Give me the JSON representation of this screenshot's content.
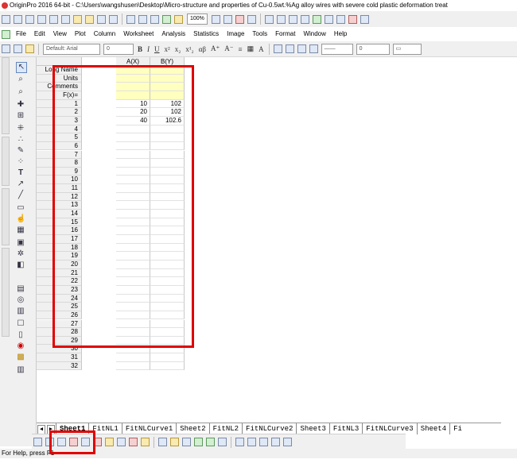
{
  "window": {
    "title": "OriginPro 2016 64-bit - C:\\Users\\wangshusen\\Desktop\\Micro-structure and properties of Cu-0.5wt.%Ag alloy wires with severe cold plastic deformation treat"
  },
  "toolbar": {
    "zoom": "100%"
  },
  "menu": [
    "File",
    "Edit",
    "View",
    "Plot",
    "Column",
    "Worksheet",
    "Analysis",
    "Statistics",
    "Image",
    "Tools",
    "Format",
    "Window",
    "Help"
  ],
  "format_bar": {
    "font": "Default: Arial",
    "size": "0",
    "line_width": "0"
  },
  "worksheet": {
    "columns": [
      "A(X)",
      "B(Y)"
    ],
    "meta_rows": [
      "Long Name",
      "Units",
      "Comments",
      "F(x)="
    ],
    "rows": [
      {
        "n": "1",
        "a": "10",
        "b": "102"
      },
      {
        "n": "2",
        "a": "20",
        "b": "102"
      },
      {
        "n": "3",
        "a": "40",
        "b": "102.6"
      },
      {
        "n": "4",
        "a": "",
        "b": ""
      },
      {
        "n": "5",
        "a": "",
        "b": ""
      },
      {
        "n": "6",
        "a": "",
        "b": ""
      },
      {
        "n": "7",
        "a": "",
        "b": ""
      },
      {
        "n": "8",
        "a": "",
        "b": ""
      },
      {
        "n": "9",
        "a": "",
        "b": ""
      },
      {
        "n": "10",
        "a": "",
        "b": ""
      },
      {
        "n": "11",
        "a": "",
        "b": ""
      },
      {
        "n": "12",
        "a": "",
        "b": ""
      },
      {
        "n": "13",
        "a": "",
        "b": ""
      },
      {
        "n": "14",
        "a": "",
        "b": ""
      },
      {
        "n": "15",
        "a": "",
        "b": ""
      },
      {
        "n": "16",
        "a": "",
        "b": ""
      },
      {
        "n": "17",
        "a": "",
        "b": ""
      },
      {
        "n": "18",
        "a": "",
        "b": ""
      },
      {
        "n": "19",
        "a": "",
        "b": ""
      },
      {
        "n": "20",
        "a": "",
        "b": ""
      },
      {
        "n": "21",
        "a": "",
        "b": ""
      },
      {
        "n": "22",
        "a": "",
        "b": ""
      },
      {
        "n": "23",
        "a": "",
        "b": ""
      },
      {
        "n": "24",
        "a": "",
        "b": ""
      },
      {
        "n": "25",
        "a": "",
        "b": ""
      },
      {
        "n": "26",
        "a": "",
        "b": ""
      },
      {
        "n": "27",
        "a": "",
        "b": ""
      },
      {
        "n": "28",
        "a": "",
        "b": ""
      },
      {
        "n": "29",
        "a": "",
        "b": ""
      },
      {
        "n": "30",
        "a": "",
        "b": ""
      },
      {
        "n": "31",
        "a": "",
        "b": ""
      },
      {
        "n": "32",
        "a": "",
        "b": ""
      }
    ]
  },
  "sheet_tabs": [
    "Sheet1",
    "FitNL1",
    "FitNLCurve1",
    "Sheet2",
    "FitNL2",
    "FitNLCurve2",
    "Sheet3",
    "FitNL3",
    "FitNLCurve3",
    "Sheet4",
    "Fi"
  ],
  "status": "For Help, press F1",
  "highlight_color": "#e00000"
}
